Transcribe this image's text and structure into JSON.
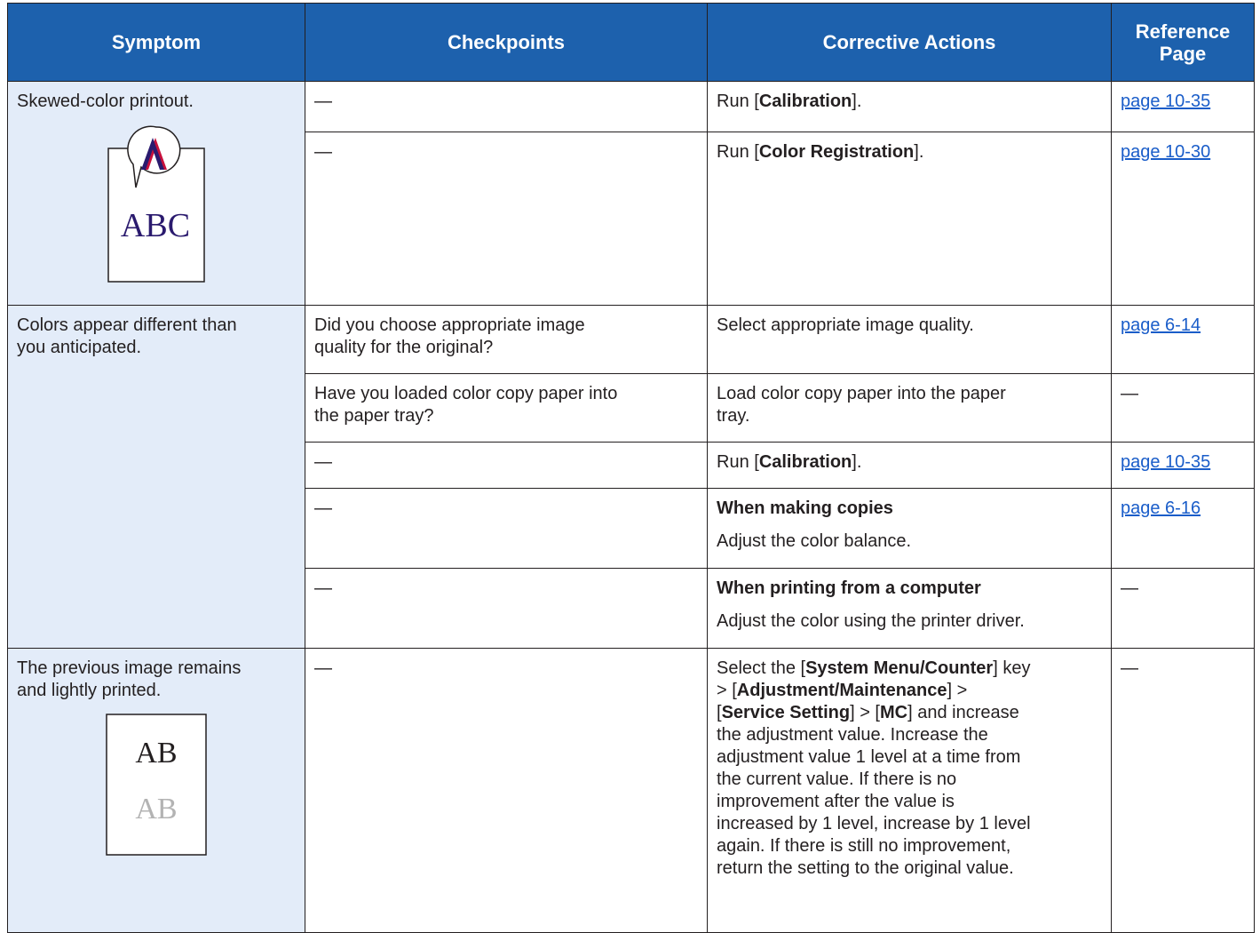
{
  "headers": {
    "symptom": "Symptom",
    "checkpoints": "Checkpoints",
    "corrective": "Corrective Actions",
    "reference_1": "Reference",
    "reference_2": "Page"
  },
  "dash": "—",
  "rows": {
    "skewed": {
      "symptom": "Skewed-color printout.",
      "figure_text": "ABC",
      "r1": {
        "pre": "Run [",
        "bold": "Calibration",
        "post": "].",
        "ref": "page 10-35"
      },
      "r2": {
        "pre": "Run [",
        "bold": "Color Registration",
        "post": "].",
        "ref": "page 10-30"
      }
    },
    "colors": {
      "symptom_1": "Colors appear different than",
      "symptom_2": "you anticipated.",
      "r1": {
        "check_1": "Did you choose appropriate image",
        "check_2": "quality for the original?",
        "action": "Select appropriate image quality.",
        "ref": "page 6-14"
      },
      "r2": {
        "check_1": "Have you loaded color copy paper into",
        "check_2": "the paper tray?",
        "action_1": "Load color copy paper into the paper",
        "action_2": "tray."
      },
      "r3": {
        "pre": "Run [",
        "bold": "Calibration",
        "post": "].",
        "ref": "page 10-35"
      },
      "r4": {
        "heading": "When making copies",
        "text": "Adjust the color balance.",
        "ref": "page 6-16"
      },
      "r5": {
        "heading": "When printing from a computer",
        "text": "Adjust the color using the printer driver."
      }
    },
    "previous": {
      "symptom_1": "The previous image remains",
      "symptom_2": "and lightly printed.",
      "figure_text_dark": "AB",
      "figure_text_light": "AB",
      "action": {
        "l1a": "Select the [",
        "l1b": "System Menu/Counter",
        "l1c": "] key",
        "l2a": "> [",
        "l2b": "Adjustment/Maintenance",
        "l2c": "] >",
        "l3a": "[",
        "l3b": "Service Setting",
        "l3c": "] > [",
        "l3d": "MC",
        "l3e": "] and increase",
        "l4": "the adjustment value. Increase the",
        "l5": "adjustment value 1 level at a time from",
        "l6": "the current value. If there is no",
        "l7": "improvement after the value is",
        "l8": "increased by 1 level, increase by 1 level",
        "l9": "again. If there is still no improvement,",
        "l10": "return the setting to the original value."
      }
    }
  },
  "colors": {
    "header_bg": "#1d61ad",
    "symptom_bg": "#e3ecf9",
    "link": "#1a5dc9",
    "figure_accent": "#c8103c",
    "figure_text": "#2a1a6e"
  }
}
